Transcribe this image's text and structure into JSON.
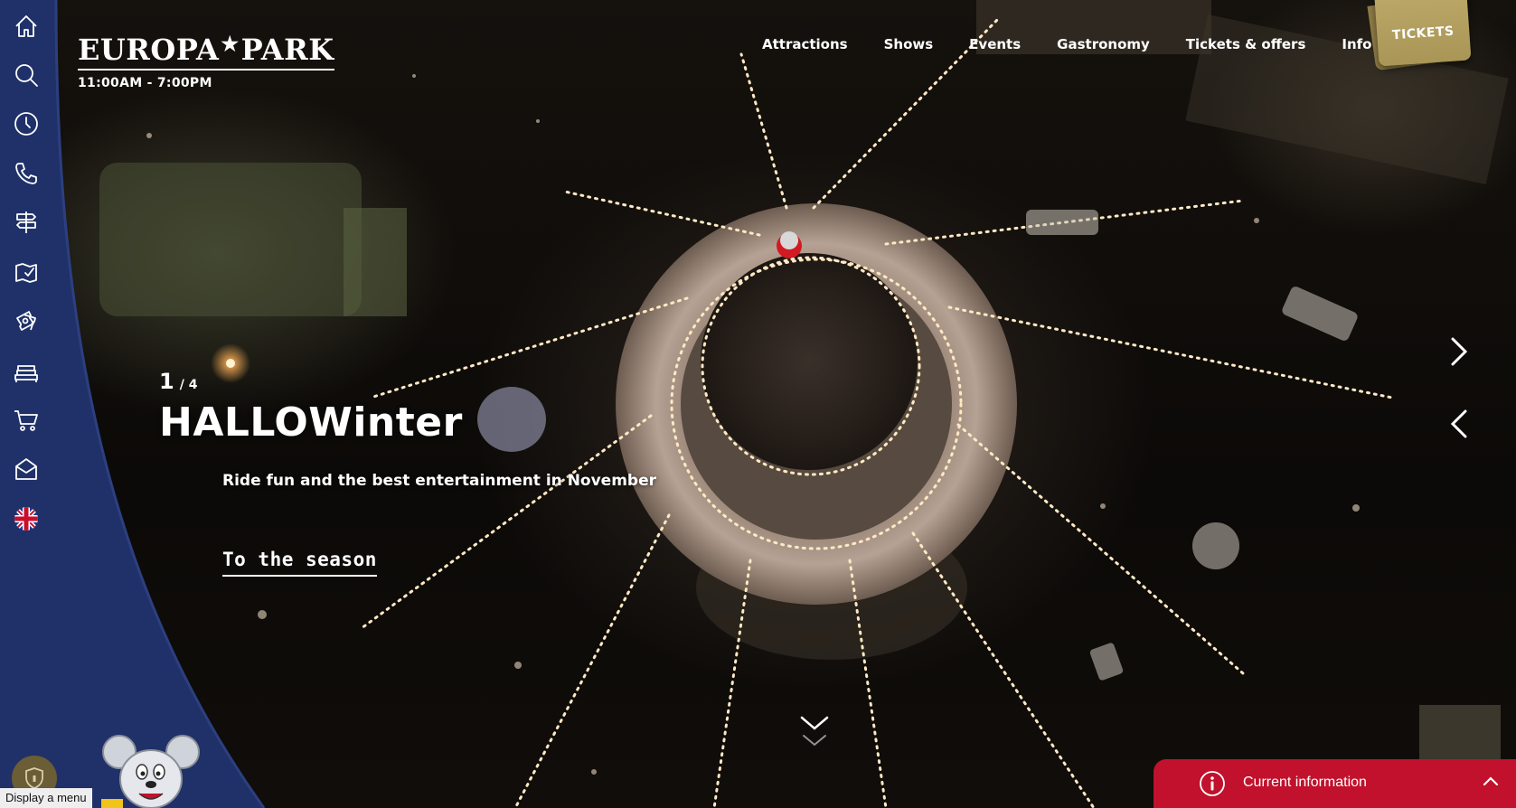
{
  "brand": {
    "logo_left": "EUROPA",
    "logo_right": "PARK",
    "hours": "11:00AM - 7:00PM"
  },
  "sidebar": {
    "items": [
      {
        "name": "home-icon"
      },
      {
        "name": "search-icon"
      },
      {
        "name": "clock-icon"
      },
      {
        "name": "phone-icon"
      },
      {
        "name": "signpost-icon"
      },
      {
        "name": "map-icon"
      },
      {
        "name": "tickets-icon"
      },
      {
        "name": "hotel-bed-icon"
      },
      {
        "name": "cart-icon"
      },
      {
        "name": "mail-icon"
      },
      {
        "name": "uk-flag-icon"
      }
    ],
    "menu_tooltip": "Display a menu"
  },
  "topnav": {
    "items": [
      "Attractions",
      "Shows",
      "Events",
      "Gastronomy",
      "Tickets & offers",
      "Info"
    ]
  },
  "tickets_button": "TICKETS",
  "slide": {
    "current": "1",
    "total": "/ 4",
    "title": "HALLOWinter",
    "subtitle": "Ride fun and the best entertainment in November",
    "link": "To the season"
  },
  "info_bar": {
    "label": "Current information"
  },
  "colors": {
    "sidebar": "#1f3168",
    "accent_red": "#c1112c",
    "ticket_gold": "#b09d5e"
  }
}
